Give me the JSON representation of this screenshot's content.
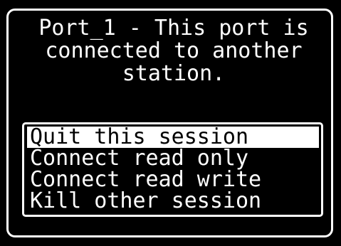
{
  "message": {
    "lines": [
      "Port_1 - This port is",
      "connected to another",
      "station."
    ]
  },
  "menu": {
    "items": [
      {
        "label": "Quit this session",
        "selected": true
      },
      {
        "label": "Connect read only",
        "selected": false
      },
      {
        "label": "Connect read write",
        "selected": false
      },
      {
        "label": "Kill other session",
        "selected": false
      }
    ]
  },
  "colors": {
    "screen_background": "#000000",
    "text": "#ffffff",
    "highlight_background": "#ffffff",
    "highlight_text": "#000000"
  }
}
